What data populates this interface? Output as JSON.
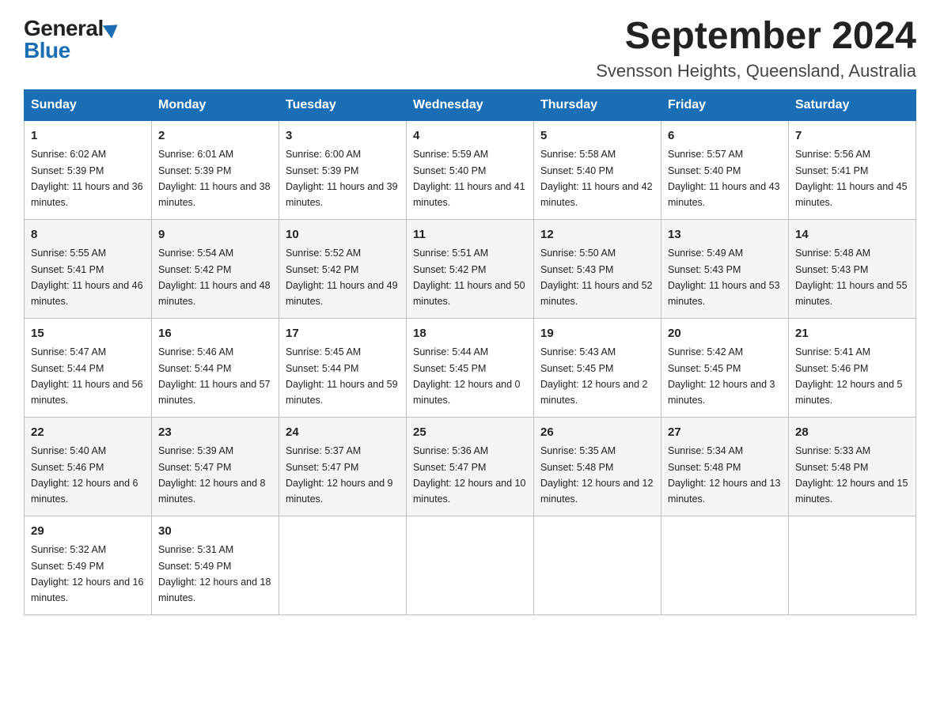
{
  "header": {
    "logo_general": "General",
    "logo_blue": "Blue",
    "month_title": "September 2024",
    "location": "Svensson Heights, Queensland, Australia"
  },
  "weekdays": [
    "Sunday",
    "Monday",
    "Tuesday",
    "Wednesday",
    "Thursday",
    "Friday",
    "Saturday"
  ],
  "weeks": [
    [
      {
        "day": "1",
        "sunrise": "6:02 AM",
        "sunset": "5:39 PM",
        "daylight": "11 hours and 36 minutes."
      },
      {
        "day": "2",
        "sunrise": "6:01 AM",
        "sunset": "5:39 PM",
        "daylight": "11 hours and 38 minutes."
      },
      {
        "day": "3",
        "sunrise": "6:00 AM",
        "sunset": "5:39 PM",
        "daylight": "11 hours and 39 minutes."
      },
      {
        "day": "4",
        "sunrise": "5:59 AM",
        "sunset": "5:40 PM",
        "daylight": "11 hours and 41 minutes."
      },
      {
        "day": "5",
        "sunrise": "5:58 AM",
        "sunset": "5:40 PM",
        "daylight": "11 hours and 42 minutes."
      },
      {
        "day": "6",
        "sunrise": "5:57 AM",
        "sunset": "5:40 PM",
        "daylight": "11 hours and 43 minutes."
      },
      {
        "day": "7",
        "sunrise": "5:56 AM",
        "sunset": "5:41 PM",
        "daylight": "11 hours and 45 minutes."
      }
    ],
    [
      {
        "day": "8",
        "sunrise": "5:55 AM",
        "sunset": "5:41 PM",
        "daylight": "11 hours and 46 minutes."
      },
      {
        "day": "9",
        "sunrise": "5:54 AM",
        "sunset": "5:42 PM",
        "daylight": "11 hours and 48 minutes."
      },
      {
        "day": "10",
        "sunrise": "5:52 AM",
        "sunset": "5:42 PM",
        "daylight": "11 hours and 49 minutes."
      },
      {
        "day": "11",
        "sunrise": "5:51 AM",
        "sunset": "5:42 PM",
        "daylight": "11 hours and 50 minutes."
      },
      {
        "day": "12",
        "sunrise": "5:50 AM",
        "sunset": "5:43 PM",
        "daylight": "11 hours and 52 minutes."
      },
      {
        "day": "13",
        "sunrise": "5:49 AM",
        "sunset": "5:43 PM",
        "daylight": "11 hours and 53 minutes."
      },
      {
        "day": "14",
        "sunrise": "5:48 AM",
        "sunset": "5:43 PM",
        "daylight": "11 hours and 55 minutes."
      }
    ],
    [
      {
        "day": "15",
        "sunrise": "5:47 AM",
        "sunset": "5:44 PM",
        "daylight": "11 hours and 56 minutes."
      },
      {
        "day": "16",
        "sunrise": "5:46 AM",
        "sunset": "5:44 PM",
        "daylight": "11 hours and 57 minutes."
      },
      {
        "day": "17",
        "sunrise": "5:45 AM",
        "sunset": "5:44 PM",
        "daylight": "11 hours and 59 minutes."
      },
      {
        "day": "18",
        "sunrise": "5:44 AM",
        "sunset": "5:45 PM",
        "daylight": "12 hours and 0 minutes."
      },
      {
        "day": "19",
        "sunrise": "5:43 AM",
        "sunset": "5:45 PM",
        "daylight": "12 hours and 2 minutes."
      },
      {
        "day": "20",
        "sunrise": "5:42 AM",
        "sunset": "5:45 PM",
        "daylight": "12 hours and 3 minutes."
      },
      {
        "day": "21",
        "sunrise": "5:41 AM",
        "sunset": "5:46 PM",
        "daylight": "12 hours and 5 minutes."
      }
    ],
    [
      {
        "day": "22",
        "sunrise": "5:40 AM",
        "sunset": "5:46 PM",
        "daylight": "12 hours and 6 minutes."
      },
      {
        "day": "23",
        "sunrise": "5:39 AM",
        "sunset": "5:47 PM",
        "daylight": "12 hours and 8 minutes."
      },
      {
        "day": "24",
        "sunrise": "5:37 AM",
        "sunset": "5:47 PM",
        "daylight": "12 hours and 9 minutes."
      },
      {
        "day": "25",
        "sunrise": "5:36 AM",
        "sunset": "5:47 PM",
        "daylight": "12 hours and 10 minutes."
      },
      {
        "day": "26",
        "sunrise": "5:35 AM",
        "sunset": "5:48 PM",
        "daylight": "12 hours and 12 minutes."
      },
      {
        "day": "27",
        "sunrise": "5:34 AM",
        "sunset": "5:48 PM",
        "daylight": "12 hours and 13 minutes."
      },
      {
        "day": "28",
        "sunrise": "5:33 AM",
        "sunset": "5:48 PM",
        "daylight": "12 hours and 15 minutes."
      }
    ],
    [
      {
        "day": "29",
        "sunrise": "5:32 AM",
        "sunset": "5:49 PM",
        "daylight": "12 hours and 16 minutes."
      },
      {
        "day": "30",
        "sunrise": "5:31 AM",
        "sunset": "5:49 PM",
        "daylight": "12 hours and 18 minutes."
      },
      null,
      null,
      null,
      null,
      null
    ]
  ]
}
